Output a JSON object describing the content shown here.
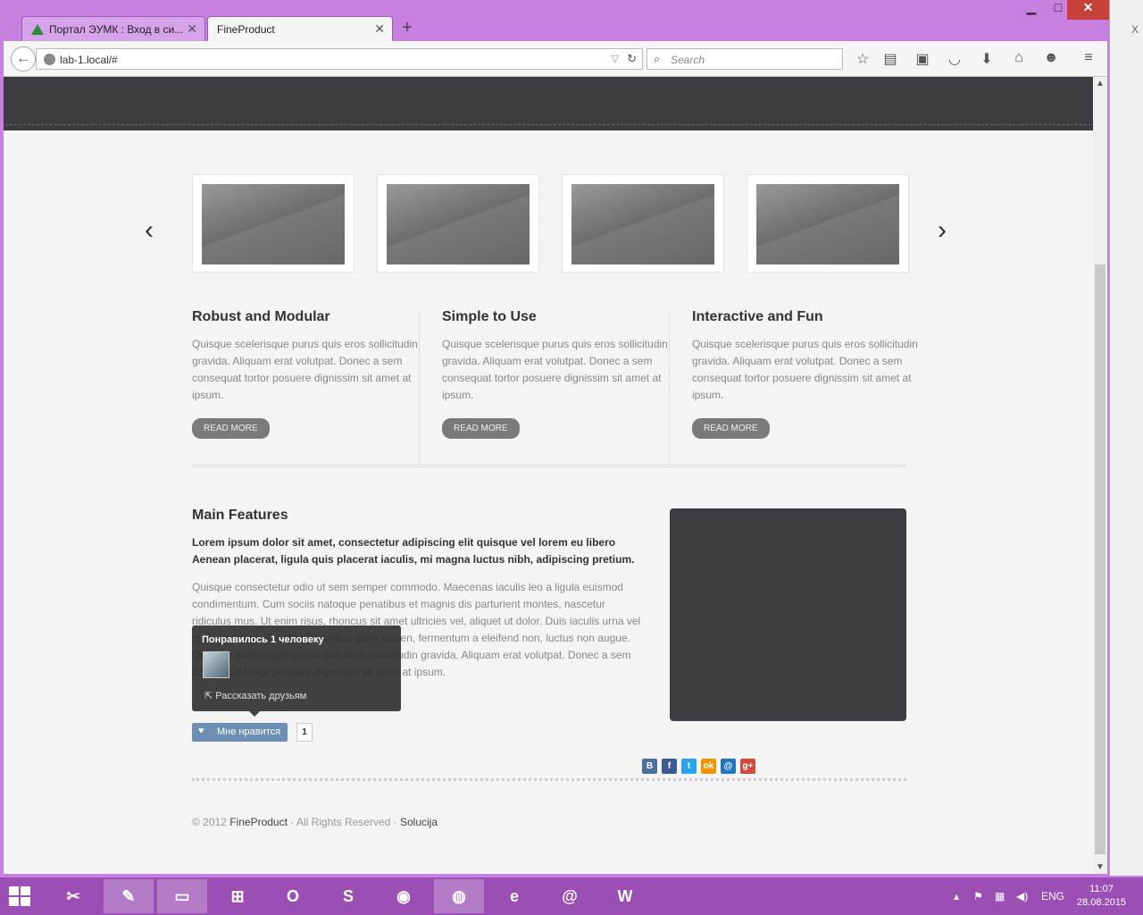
{
  "browser": {
    "tabs": [
      {
        "label": "Портал ЭУМК : Вход в си...",
        "active": false
      },
      {
        "label": "FineProduct",
        "active": true
      }
    ],
    "new_tab": "+",
    "window_controls": {
      "minimize": "▁",
      "maximize": "□",
      "close": "✕"
    },
    "url": "lab-1.local/#",
    "search_placeholder": "Search"
  },
  "page": {
    "carousel": {
      "prev": "‹",
      "next": "›",
      "items": 4
    },
    "columns": [
      {
        "title": "Robust and Modular",
        "text": "Quisque scelerisque purus quis eros sollicitudin gravida. Aliquam erat volutpat. Donec a sem consequat tortor posuere dignissim sit amet at ipsum.",
        "button": "READ MORE"
      },
      {
        "title": "Simple to Use",
        "text": "Quisque scelerisque purus quis eros sollicitudin gravida. Aliquam erat volutpat. Donec a sem consequat tortor posuere dignissim sit amet at ipsum.",
        "button": "READ MORE"
      },
      {
        "title": "Interactive and Fun",
        "text": "Quisque scelerisque purus quis eros sollicitudin gravida. Aliquam erat volutpat. Donec a sem consequat tortor posuere dignissim sit amet at ipsum.",
        "button": "READ MORE"
      }
    ],
    "features": {
      "title": "Main Features",
      "lead": "Lorem ipsum dolor sit amet, consectetur adipiscing elit quisque vel lorem eu libero Aenean placerat, ligula quis placerat iaculis, mi magna luctus nibh, adipiscing pretium.",
      "body": "Quisque consectetur odio ut sem semper commodo. Maecenas iaculis leo a ligula euismod condimentum. Cum sociis natoque penatibus et magnis dis parturient montes, nascetur ridiculus mus. Ut enim risus, rhoncus sit amet ultricies vel, aliquet ut dolor. Duis iaculis urna vel massa ultrices suscipit. Phasellus diam sapien, fermentum a eleifend non, luctus non augue. Quisque scelerisque purus quis eros sollicitudin gravida. Aliquam erat volutpat. Donec a sem consequat tortor posuere dignissim sit amet at ipsum."
    },
    "like_widget": {
      "popup_title": "Понравилось 1 человеку",
      "share": "Рассказать друзьям",
      "button": "Мне нравится",
      "count": "1"
    },
    "social": [
      {
        "label": "B",
        "color": "#4a6fa0"
      },
      {
        "label": "f",
        "color": "#3b5998"
      },
      {
        "label": "t",
        "color": "#2aa3ef"
      },
      {
        "label": "ok",
        "color": "#f29400"
      },
      {
        "label": "@",
        "color": "#1f74c0"
      },
      {
        "label": "g+",
        "color": "#d34836"
      }
    ],
    "footer": {
      "copy": "© 2012 ",
      "brand": "FineProduct",
      "rights": " · All Rights Reserved · ",
      "link": "Solucija"
    }
  },
  "taskbar": {
    "tray_lang": "ENG",
    "time": "11:07",
    "date": "28.08.2015"
  }
}
